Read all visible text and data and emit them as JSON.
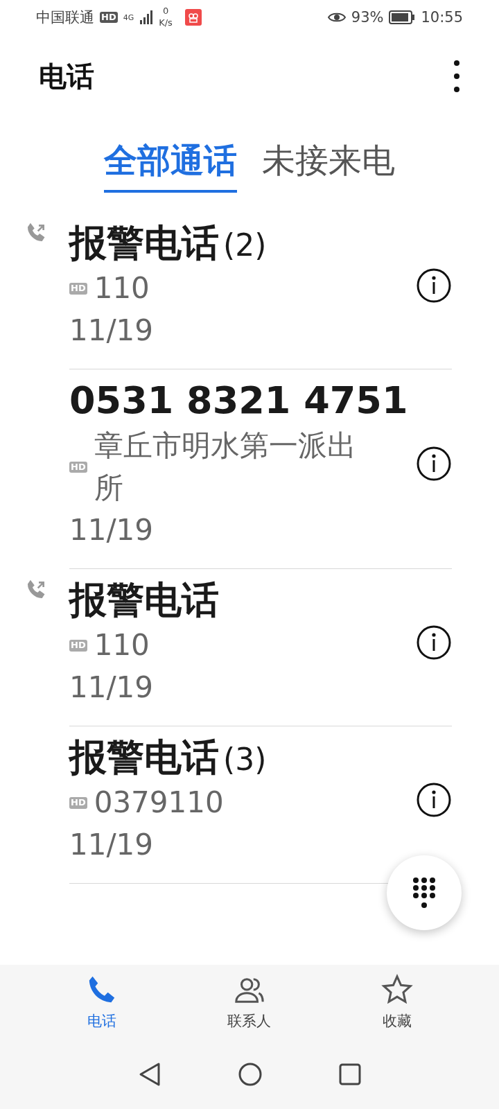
{
  "status_bar": {
    "carrier": "中国联通",
    "hd_badge": "HD",
    "network": "4G",
    "speed_value": "0",
    "speed_unit": "K/s",
    "battery_percent": "93%",
    "time": "10:55"
  },
  "header": {
    "title": "电话"
  },
  "tabs": [
    {
      "label": "全部通话",
      "selected": true
    },
    {
      "label": "未接来电",
      "selected": false
    }
  ],
  "calls": [
    {
      "name": "报警电话",
      "count": "(2)",
      "outgoing": true,
      "badge": "HD",
      "detail": "110",
      "date": "11/19"
    },
    {
      "name": "0531 8321 4751",
      "outgoing": false,
      "badge": "HD",
      "detail": "章丘市明水第一派出所",
      "date": "11/19"
    },
    {
      "name": "报警电话",
      "outgoing": true,
      "badge": "HD",
      "detail": "110",
      "date": "11/19"
    },
    {
      "name": "报警电话",
      "count": "(3)",
      "outgoing": false,
      "badge": "HD",
      "detail": "0379110",
      "date": "11/19"
    }
  ],
  "bottom_nav": [
    {
      "kind": "phone",
      "label": "电话",
      "selected": true
    },
    {
      "kind": "contacts",
      "label": "联系人",
      "selected": false
    },
    {
      "kind": "favorites",
      "label": "收藏",
      "selected": false
    }
  ]
}
